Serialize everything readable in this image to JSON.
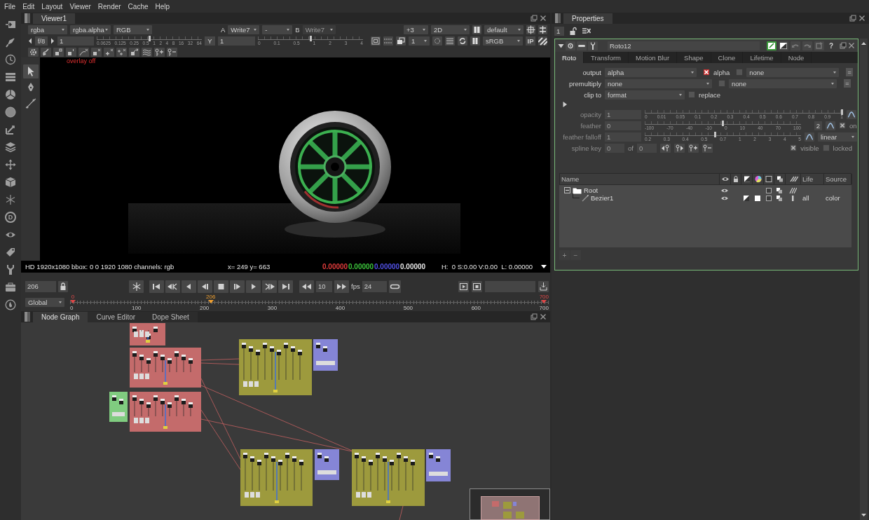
{
  "menu_bar": [
    "File",
    "Edit",
    "Layout",
    "Viewer",
    "Render",
    "Cache",
    "Help"
  ],
  "left_toolbar": {
    "letter_icon": "D"
  },
  "viewer": {
    "tab": {
      "label": "Viewer1",
      "selected": true
    },
    "toolbar": {
      "channels": "rgba",
      "layer": "rgba.alpha",
      "display": "RGB",
      "a_label": "A",
      "input_a": "Write7",
      "wipe": "-",
      "b_label": "B",
      "input_b": {
        "value": "Write7",
        "disabled": true
      },
      "downrez": "+3",
      "mode": "2D",
      "lut_set": "default",
      "fstop": "f/8",
      "gain": "1",
      "gain_slider": {
        "level": 0.5,
        "ticks": [
          "0.0625",
          "0.125",
          "0.25",
          "0.5",
          "1",
          "2",
          "4",
          "8",
          "16",
          "32",
          "64"
        ]
      },
      "gamma_button": "Y",
      "gamma": "1",
      "gamma_slider": {
        "level": 0.5,
        "ticks": [
          "0",
          "0.1",
          "0.5",
          "1",
          "2",
          "3",
          "4"
        ]
      },
      "proxy": "1",
      "colorspace": "sRGB",
      "input_process": "IP"
    },
    "tools": [
      {
        "kind": "pointer",
        "selected": true
      },
      {
        "kind": "pen",
        "selected": false
      },
      {
        "kind": "curve",
        "selected": false
      }
    ],
    "overlay": "overlay off",
    "status": {
      "format": "HD 1920x1080 bbox: 0 0 1920 1080 channels: rgb",
      "position": "x= 249 y= 663",
      "samples": [
        {
          "value": "0.00000",
          "color": "#e03c3c"
        },
        {
          "value": "0.00000",
          "color": "#3cc43c"
        },
        {
          "value": "0.00000",
          "color": "#5252e6"
        },
        {
          "value": "0.00000",
          "color": "#e6e6e6"
        }
      ],
      "hsvl": "H:  0 S:0.00 V:0.00  L: 0.00000"
    }
  },
  "playback": {
    "frame": "206",
    "step": "10",
    "fps_label": "fps",
    "fps": "24",
    "range_mode": "Global",
    "ticks": [
      "0",
      "100",
      "200",
      "300",
      "400",
      "500",
      "600",
      "700"
    ],
    "in_point": "0",
    "current": "206",
    "out_point": "700",
    "level": 0.294
  },
  "node_graph": {
    "tabs": [
      {
        "label": "Node Graph",
        "selected": true
      },
      {
        "label": "Curve Editor",
        "selected": false
      },
      {
        "label": "Dope Sheet",
        "selected": false
      }
    ],
    "backdrops": [
      {
        "color": "#c46b6b"
      },
      {
        "color": "#c46b6b"
      },
      {
        "color": "#9d9a3d"
      },
      {
        "color": "#8585d6"
      },
      {
        "color": "#80cc80"
      },
      {
        "color": "#c46b6b"
      },
      {
        "color": "#9d9a3d"
      },
      {
        "color": "#8585d6"
      },
      {
        "color": "#9d9a3d"
      },
      {
        "color": "#8585d6"
      }
    ]
  },
  "properties": {
    "tab": {
      "label": "Properties",
      "selected": true
    },
    "max_panels": "1",
    "node": {
      "name": "Roto12",
      "help": "?",
      "tabs": [
        {
          "label": "Roto",
          "selected": true
        },
        {
          "label": "Transform",
          "selected": false
        },
        {
          "label": "Motion Blur",
          "selected": false
        },
        {
          "label": "Shape",
          "selected": false
        },
        {
          "label": "Clone",
          "selected": false
        },
        {
          "label": "Lifetime",
          "selected": false
        },
        {
          "label": "Node",
          "selected": false
        }
      ],
      "output": {
        "label": "output",
        "value": "alpha",
        "channel": {
          "label": "alpha",
          "checked": true
        },
        "mask_checked": false,
        "mask": "none",
        "link": "="
      },
      "premultiply": {
        "label": "premultiply",
        "value": "none",
        "mask_checked": false,
        "mask": "none",
        "link": "="
      },
      "clip_to": {
        "label": "clip to",
        "value": "format",
        "replace": {
          "label": "replace",
          "checked": false
        }
      },
      "more_expanded": false,
      "opacity": {
        "label": "opacity",
        "value": "1",
        "disabled": true,
        "level": 1,
        "ticks": [
          "0",
          "0.01",
          "0.05",
          "0.1",
          "0.2",
          "0.3",
          "0.4",
          "0.5",
          "0.6",
          "0.7",
          "0.8",
          "0.9",
          "1"
        ]
      },
      "feather": {
        "label": "feather",
        "value": "0",
        "disabled": true,
        "level": 0.5,
        "ticks": [
          "-100",
          "-70",
          "-40",
          "-10",
          "0",
          "10",
          "40",
          "70",
          "100"
        ],
        "dimension": "2",
        "on": {
          "label": "on",
          "checked": true
        }
      },
      "feather_falloff": {
        "label": "feather falloff",
        "value": "1",
        "disabled": true,
        "level": 0.45,
        "ticks": [
          "0.2",
          "0.3",
          "0.4",
          "0.5",
          "0.7",
          "1",
          "2",
          "3",
          "4",
          "5"
        ],
        "type": "linear"
      },
      "spline_key": {
        "label": "spline key",
        "value": "0",
        "of_label": "of",
        "total": "0",
        "disabled": true,
        "visible": {
          "label": "visible",
          "checked": true
        },
        "locked": {
          "label": "locked",
          "checked": false
        }
      },
      "curves": {
        "columns": [
          "Name",
          "Life",
          "Source"
        ],
        "items": [
          {
            "name": "Root",
            "expanded": true,
            "children": [
              {
                "name": "Bezier1",
                "life": "all",
                "source": "color"
              }
            ]
          }
        ],
        "add": "+",
        "remove": "−"
      }
    }
  }
}
